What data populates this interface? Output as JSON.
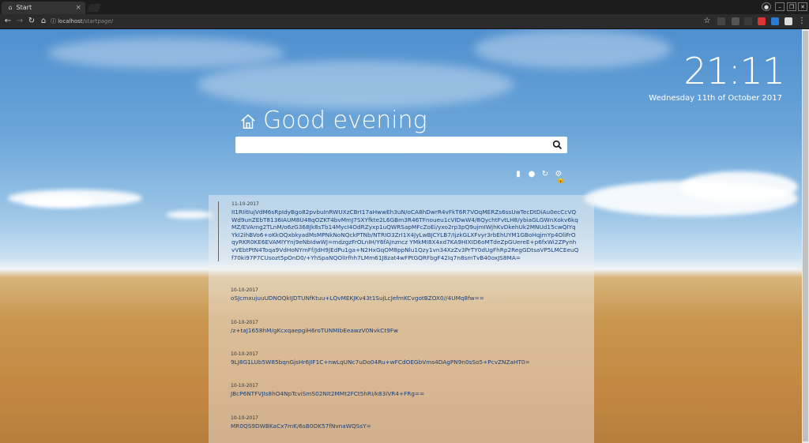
{
  "browser": {
    "tab_title": "Start",
    "tab_close": "×",
    "url_host": "localhost",
    "url_path": "/startpage/",
    "window_controls": [
      "●",
      "–",
      "❐",
      "✕"
    ]
  },
  "clock": {
    "time": "21:11",
    "date": "Wednesday 11th of October 2017"
  },
  "greeting": "Good evening",
  "search": {
    "placeholder": ""
  },
  "entries": [
    {
      "date": "11-10-2017",
      "text": "II1RIitIujVdM6sRpIdyBgo82pvbuInRWUXzCBrI17aHwwEh3uN/oCA8hDwrR4vFkT6R7VOqMERZs6ssUwTecDtDiAu0ecCcVQWd9unZEbT8136IAUM8U48qOZKT4bvMmJ7SXYfkte2L6GBm3R46TFnoueu1cVIDwW4/8QychtFvtLH8/ybiaGLGWnXokv6kqMZ/EVAmg2TLnM/o6zG368Jk8sTb14MycI4OdRZyxp1uQWRSapMFcZoEi/yxo2rp3pQ9ujmIWjhKvDkehUk2MNUd15cwQIYqYkI2ihBVo6+oKkOQxbkyadMsMPNkNoNQckPTNb/NTRIO3ZrI1X4JyLwBJCYLB7/IjzkGLXFvyr3rbEhUYM1GBoHqjmYp4OliFrOqyRKR0KE6EVAMIYYnj9eNbIdwWJ=mdzgzFrOLnIH/Y6fAJnzncz YMkMI8X4xd7KA9HIXID6oMTdeZpGUereE+p6fxWi2ZPynhvVEbtPtN4Toqa9VdHoNYmFf/JdH9JEdPu1ga+N2HxGqOM8ppNlu1Qzy1vn34XzZv3PrTY0dUgFhRp2RegGDtsaVP5LMCEeuQf70ki97P7CUsozt5pOnD0/+YhSpaNQOlIrfhh7LMm61J8zat4wFPtGQRFbgF42Iq7n8smTvB40oxJS8MA="
    },
    {
      "date": "10-10-2017",
      "text": "oSJcmxujuuUDNOQkIJDTUNfKtuu+LQvMEKJKv43t1SujLcJefmKCvgotBZOX0//4UMq8fw=="
    },
    {
      "date": "10-10-2017",
      "text": "/z+taJ1658hM/gKcxqaepgiH6roTUNMIbEeawzV0NvkCt9Fw"
    },
    {
      "date": "10-10-2017",
      "text": "9LJ8G1LUb5W85bqnGjsHr6JIF1C+nwLqUNc7uDo04Ru+wFCdOEGbVms4DAgPN9n0sSo5+PcvZNZaHT0="
    },
    {
      "date": "10-10-2017",
      "text": "JBcP6NTFVJIs8hO4NpTcviSmS02NIt2MMt2FCt5hRI/k83iVR4+FRg=="
    },
    {
      "date": "10-10-2017",
      "text": "MR0QS9DWBKaCx7mK/6sB0OK57fNvnaWQSsY="
    }
  ],
  "colors": {
    "sky": "#6ba5d9",
    "field": "#c48a44",
    "link": "#1a3f7a"
  }
}
